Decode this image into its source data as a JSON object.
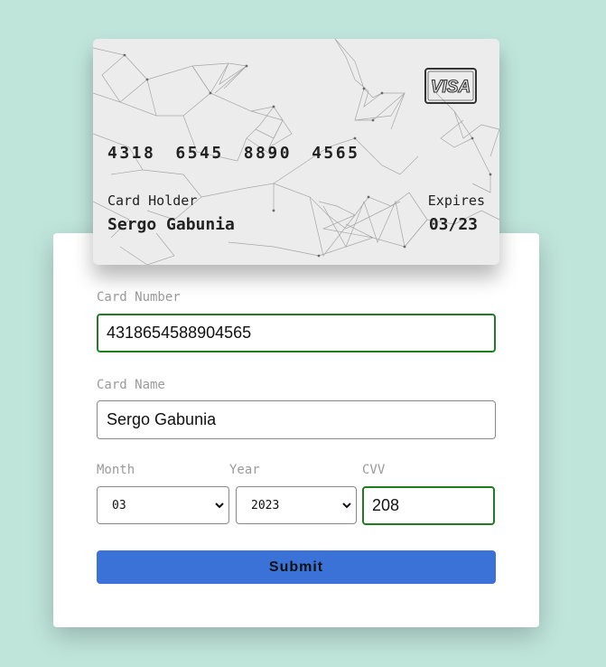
{
  "card": {
    "number_groups": [
      "4318",
      "6545",
      "8890",
      "4565"
    ],
    "holder_label": "Card Holder",
    "holder_name": "Sergo Gabunia",
    "expires_label": "Expires",
    "expires_value": "03/23",
    "brand": "VISA"
  },
  "form": {
    "card_number_label": "Card Number",
    "card_number_value": "4318654588904565",
    "card_name_label": "Card Name",
    "card_name_value": "Sergo Gabunia",
    "month_label": "Month",
    "month_value": "03",
    "year_label": "Year",
    "year_value": "2023",
    "cvv_label": "CVV",
    "cvv_value": "208",
    "submit_label": "Submit"
  },
  "colors": {
    "background": "#bfe5db",
    "focus_border": "#1e7d1e",
    "submit": "#3a72d8"
  }
}
